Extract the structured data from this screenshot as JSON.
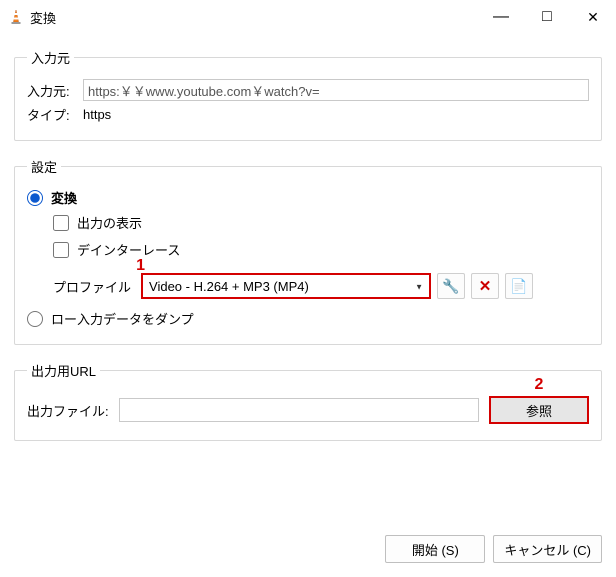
{
  "window": {
    "title": "変換"
  },
  "source_section": {
    "legend": "入力元",
    "source_label": "入力元:",
    "source_value": "https:￥￥www.youtube.com￥watch?v=",
    "type_label": "タイプ:",
    "type_value": "https"
  },
  "settings_section": {
    "legend": "設定",
    "convert_label": "変換",
    "display_output_label": "出力の表示",
    "deinterlace_label": "デインターレース",
    "profile_label": "プロファイル",
    "profile_value": "Video - H.264 + MP3 (MP4)",
    "dump_label": "ロー入力データをダンプ"
  },
  "output_section": {
    "legend": "出力用URL",
    "file_label": "出力ファイル:",
    "browse_label": "参照"
  },
  "footer": {
    "start_label": "開始 (S)",
    "cancel_label": "キャンセル (C)"
  },
  "markers": {
    "one": "1",
    "two": "2"
  },
  "icons": {
    "wrench": "🔧",
    "delete": "✕",
    "new_profile": "📄"
  }
}
